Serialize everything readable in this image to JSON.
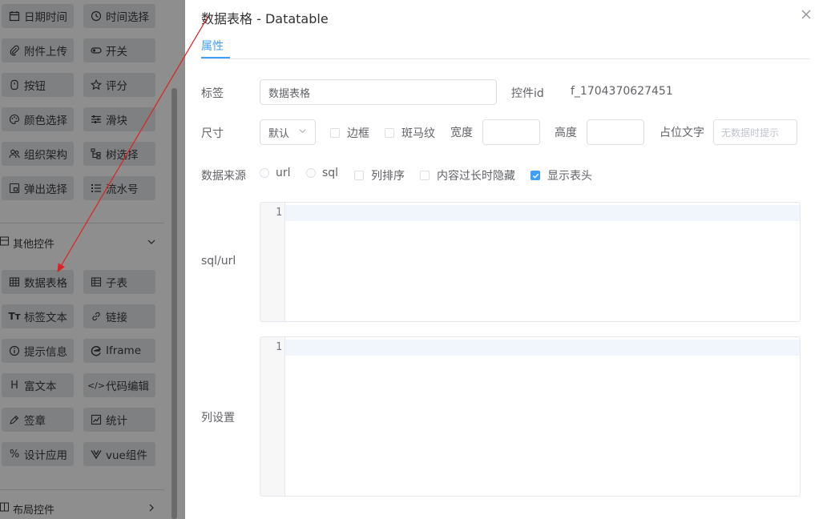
{
  "widgets": {
    "row1": [
      "日期时间",
      "时间选择"
    ],
    "row2": [
      "附件上传",
      "开关"
    ],
    "row3": [
      "按钮",
      "评分"
    ],
    "row4": [
      "颜色选择",
      "滑块"
    ],
    "row5": [
      "组织架构",
      "树选择"
    ],
    "row6": [
      "弹出选择",
      "流水号"
    ],
    "other_section": "其他控件",
    "row7": [
      "数据表格",
      "子表"
    ],
    "row8": [
      "标签文本",
      "链接"
    ],
    "row9": [
      "提示信息",
      "Iframe"
    ],
    "row10": [
      "富文本",
      "代码编辑"
    ],
    "row11": [
      "签章",
      "统计"
    ],
    "row12": [
      "设计应用",
      "vue组件"
    ],
    "layout_section": "布局控件"
  },
  "dialog": {
    "title": "数据表格 - Datatable",
    "tab": "属性",
    "label_label": "标签",
    "label_value": "数据表格",
    "control_id_label": "控件id",
    "control_id_value": "f_1704370627451",
    "size_label": "尺寸",
    "size_value": "默认",
    "border_label": "边框",
    "stripe_label": "斑马纹",
    "width_label": "宽度",
    "height_label": "高度",
    "placeholder_label": "占位文字",
    "placeholder_value": "无数据时提示",
    "source_label": "数据来源",
    "source_url": "url",
    "source_sql": "sql",
    "col_sort_label": "列排序",
    "hide_overflow_label": "内容过长时隐藏",
    "show_header_label": "显示表头",
    "show_header_checked": true,
    "sqlurl_label": "sql/url",
    "editor1_line": "1",
    "colset_label": "列设置",
    "editor2_line": "1"
  },
  "colors": {
    "accent": "#409eff",
    "overlay": "#8e8e8e",
    "arrow": "#e02020"
  }
}
